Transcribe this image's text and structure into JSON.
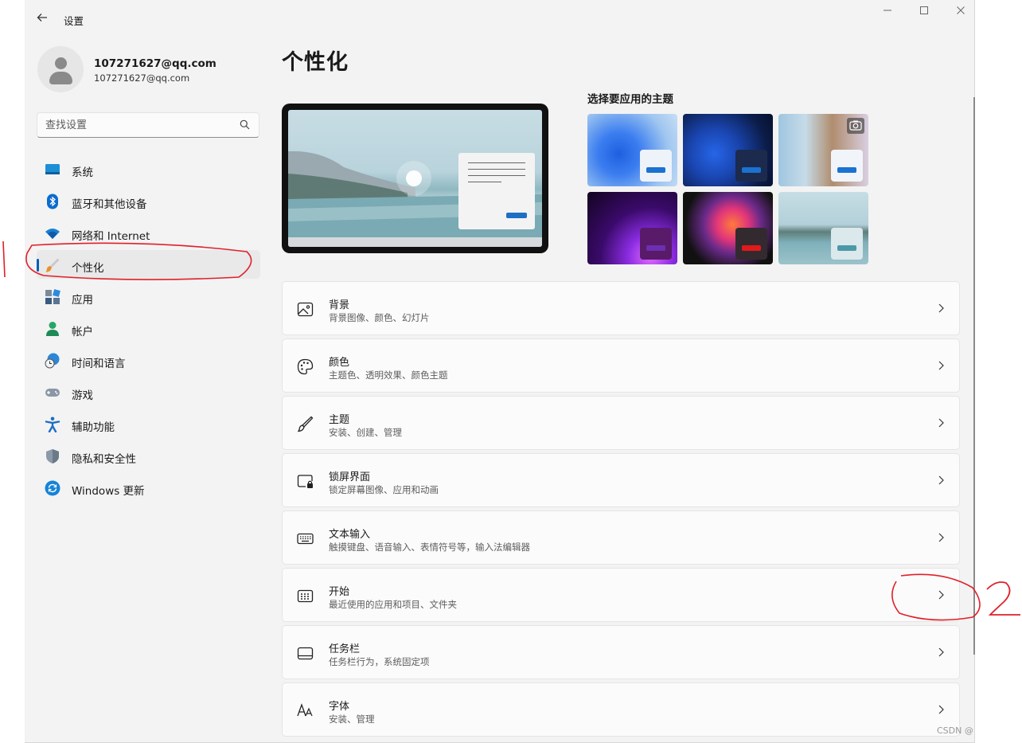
{
  "titlebar": {
    "title": "设置",
    "back_icon": "arrow-left-icon"
  },
  "account": {
    "name": "107271627@qq.com",
    "email": "107271627@qq.com"
  },
  "search": {
    "placeholder": "查找设置"
  },
  "sidebar": {
    "items": [
      {
        "label": "系统",
        "icon": "system-icon"
      },
      {
        "label": "蓝牙和其他设备",
        "icon": "bluetooth-icon"
      },
      {
        "label": "网络和 Internet",
        "icon": "wifi-icon"
      },
      {
        "label": "个性化",
        "icon": "brush-icon",
        "active": true
      },
      {
        "label": "应用",
        "icon": "apps-icon"
      },
      {
        "label": "帐户",
        "icon": "account-icon"
      },
      {
        "label": "时间和语言",
        "icon": "globe-clock-icon"
      },
      {
        "label": "游戏",
        "icon": "gamepad-icon"
      },
      {
        "label": "辅助功能",
        "icon": "accessibility-icon"
      },
      {
        "label": "隐私和安全性",
        "icon": "shield-icon"
      },
      {
        "label": "Windows 更新",
        "icon": "update-icon"
      }
    ]
  },
  "main": {
    "title": "个性化",
    "themes_heading": "选择要应用的主题",
    "cards": [
      {
        "title": "背景",
        "subtitle": "背景图像、颜色、幻灯片",
        "icon": "image-icon"
      },
      {
        "title": "颜色",
        "subtitle": "主题色、透明效果、颜色主题",
        "icon": "palette-icon"
      },
      {
        "title": "主题",
        "subtitle": "安装、创建、管理",
        "icon": "brush-icon"
      },
      {
        "title": "锁屏界面",
        "subtitle": "锁定屏幕图像、应用和动画",
        "icon": "lock-screen-icon"
      },
      {
        "title": "文本输入",
        "subtitle": "触摸键盘、语音输入、表情符号等，输入法编辑器",
        "icon": "keyboard-icon"
      },
      {
        "title": "开始",
        "subtitle": "最近使用的应用和项目、文件夹",
        "icon": "start-icon"
      },
      {
        "title": "任务栏",
        "subtitle": "任务栏行为，系统固定项",
        "icon": "taskbar-icon"
      },
      {
        "title": "字体",
        "subtitle": "安装、管理",
        "icon": "font-icon"
      }
    ]
  },
  "colors": {
    "accent": "#005fb8",
    "annotation": "#e0202a"
  },
  "watermark": "CSDN @"
}
